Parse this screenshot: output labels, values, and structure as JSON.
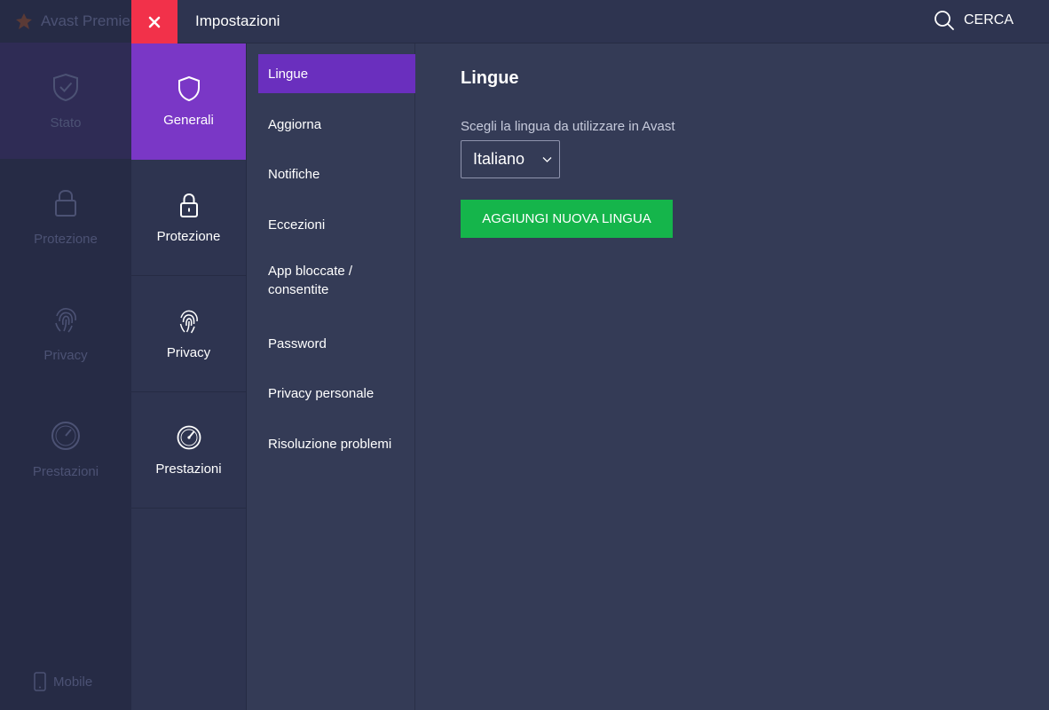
{
  "background_app": {
    "title": "Avast Premier",
    "nav": [
      {
        "label": "Stato",
        "icon": "shield-check-icon"
      },
      {
        "label": "Protezione",
        "icon": "lock-icon"
      },
      {
        "label": "Privacy",
        "icon": "fingerprint-icon"
      },
      {
        "label": "Prestazioni",
        "icon": "speedometer-icon"
      }
    ],
    "mobile_label": "Mobile"
  },
  "topbar": {
    "title": "Impostazioni",
    "search_label": "CERCA"
  },
  "categories": [
    {
      "label": "Generali",
      "icon": "shield-icon",
      "active": true
    },
    {
      "label": "Protezione",
      "icon": "lock-icon",
      "active": false
    },
    {
      "label": "Privacy",
      "icon": "fingerprint-icon",
      "active": false
    },
    {
      "label": "Prestazioni",
      "icon": "speedometer-icon",
      "active": false
    }
  ],
  "subnav": [
    {
      "label": "Lingue",
      "active": true
    },
    {
      "label": "Aggiorna",
      "active": false
    },
    {
      "label": "Notifiche",
      "active": false
    },
    {
      "label": "Eccezioni",
      "active": false
    },
    {
      "label": "App bloccate / consentite",
      "active": false
    },
    {
      "label": "Password",
      "active": false
    },
    {
      "label": "Privacy personale",
      "active": false
    },
    {
      "label": "Risoluzione problemi",
      "active": false
    }
  ],
  "content": {
    "title": "Lingue",
    "language_label": "Scegli la lingua da utilizzare in Avast",
    "selected_language": "Italiano",
    "add_button": "AGGIUNGI NUOVA LINGUA"
  },
  "colors": {
    "close_red": "#f2314a",
    "active_purple": "#7a37c6",
    "green_button": "#15b54b"
  }
}
